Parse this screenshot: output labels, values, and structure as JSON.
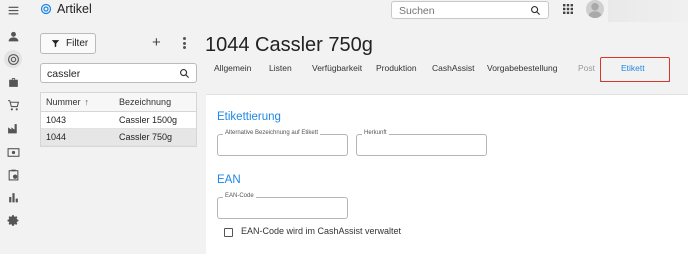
{
  "app": {
    "title": "Artikel",
    "search_placeholder": "Suchen",
    "accent_color": "#1e88e5"
  },
  "rail": {
    "icons": [
      "menu-icon",
      "person-icon",
      "coin-icon",
      "briefcase-icon",
      "cart-icon",
      "factory-icon",
      "cash-icon",
      "clipboard-icon",
      "bar-chart-icon",
      "settings-icon"
    ]
  },
  "list": {
    "filter_label": "Filter",
    "add_label": "+",
    "search_value": "cassler",
    "columns": [
      "Nummer",
      "Bezeichnung"
    ],
    "rows": [
      {
        "nummer": "1043",
        "bezeichnung": "Cassler 1500g",
        "selected": false
      },
      {
        "nummer": "1044",
        "bezeichnung": "Cassler 750g",
        "selected": true
      }
    ]
  },
  "detail": {
    "title": "1044 Cassler 750g",
    "tabs": [
      {
        "label": "Allgemein"
      },
      {
        "label": "Listen"
      },
      {
        "label": "Verfügbarkeit"
      },
      {
        "label": "Produktion"
      },
      {
        "label": "CashAssist"
      },
      {
        "label": "Vorgabebestellung"
      },
      {
        "label": "Post"
      },
      {
        "label": "Etikett"
      }
    ],
    "active_tab": "Etikett",
    "highlight_color": "#d9352a",
    "sections": {
      "etikettierung": {
        "title": "Etikettierung",
        "alt_name_label": "Alternative Bezeichnung auf Etikett",
        "alt_name_value": "",
        "herkunft_label": "Herkunft",
        "herkunft_value": ""
      },
      "ean": {
        "title": "EAN",
        "ean_label": "EAN-Code",
        "ean_value": "",
        "cashassist_checkbox_label": "EAN-Code wird im CashAssist verwaltet",
        "cashassist_checked": false
      }
    }
  }
}
